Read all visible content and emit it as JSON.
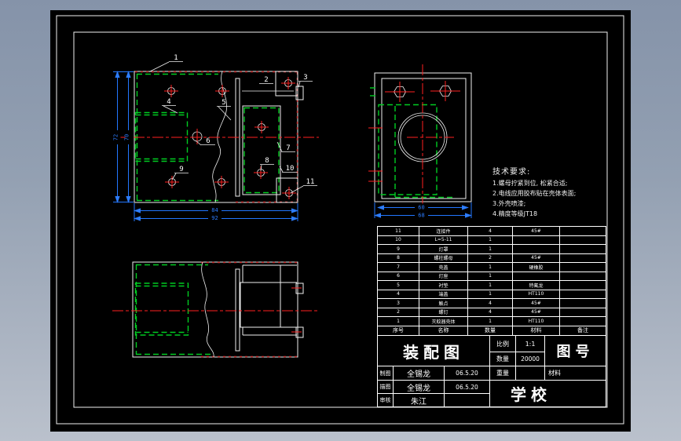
{
  "drawing": {
    "balloons": [
      "1",
      "2",
      "3",
      "4",
      "5",
      "6",
      "7",
      "8",
      "9",
      "10",
      "11"
    ],
    "dims": {
      "lv_h_outer": "72",
      "lv_h_inner": "70",
      "lv_w_inner": "84",
      "lv_w_outer": "92",
      "rv_w_inner": "60",
      "rv_w_outer": "68"
    }
  },
  "tech_requirements": {
    "title": "技术要求:",
    "lines": [
      "1.螺母拧紧到位, 松紧合适;",
      "2.电线应用胶布贴在壳体表面;",
      "3.外壳喷漆;",
      "4.精度等级JT18"
    ]
  },
  "parts_table": {
    "headers": [
      "序号",
      "名称",
      "数量",
      "材料",
      "备注"
    ],
    "rows": [
      [
        "11",
        "连接件",
        "4",
        "45#",
        ""
      ],
      [
        "10",
        "L=5-11",
        "1",
        "",
        ""
      ],
      [
        "9",
        "灯罩",
        "1",
        "",
        ""
      ],
      [
        "8",
        "螺柱螺母",
        "2",
        "45#",
        ""
      ],
      [
        "7",
        "壳盖",
        "1",
        "硬橡胶",
        ""
      ],
      [
        "6",
        "灯座",
        "1",
        "",
        ""
      ],
      [
        "5",
        "衬垫",
        "1",
        "特氟龙",
        ""
      ],
      [
        "4",
        "端盖",
        "1",
        "HT110",
        ""
      ],
      [
        "3",
        "触点",
        "4",
        "45#",
        ""
      ],
      [
        "2",
        "螺钉",
        "4",
        "45#",
        ""
      ],
      [
        "1",
        "灭蚊器壳体",
        "1",
        "HT110",
        ""
      ]
    ]
  },
  "title_block": {
    "title": "装配图",
    "drawing_no": "图号",
    "scale_label": "比例",
    "scale_value": "1:1",
    "qty_label": "数量",
    "qty_value": "20000",
    "weight_label": "重量",
    "material_label": "材料",
    "school": "学校",
    "made_label": "制图",
    "made_by": "全锡龙",
    "made_date": "06.5.20",
    "traced_label": "描图",
    "traced_by": "全锡龙",
    "traced_date": "06.5.20",
    "checked_label": "审核",
    "checked_by": "朱江",
    "checked_date": ""
  }
}
